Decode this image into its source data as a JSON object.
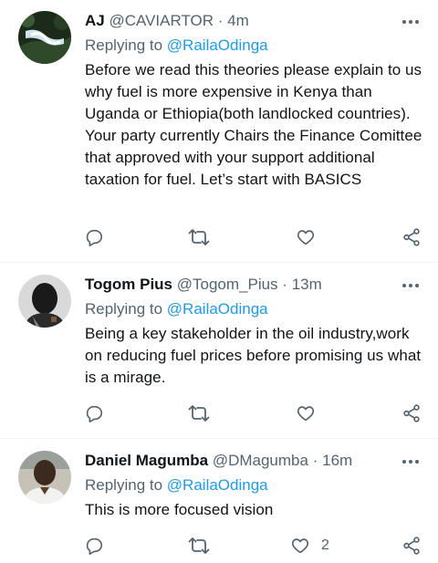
{
  "replies": [
    {
      "name": "AJ",
      "handle": "@CAVIARTOR",
      "separator": "·",
      "time": "4m",
      "replying_prefix": "Replying to",
      "replying_handle": "@RailaOdinga",
      "text": "Before we read this theories please explain to us why fuel is more expensive in Kenya than Uganda or Ethiopia(both landlocked countries). Your party currently Chairs the Finance Comittee that approved with your support additional taxation for fuel. Let’s start with BASICS",
      "like_count": ""
    },
    {
      "name": "Togom Pius",
      "handle": "@Togom_Pius",
      "separator": "·",
      "time": "13m",
      "replying_prefix": "Replying to",
      "replying_handle": "@RailaOdinga",
      "text": "Being a key stakeholder in the oil industry,work on reducing fuel prices before promising us what is a mirage.",
      "like_count": ""
    },
    {
      "name": "Daniel Magumba",
      "handle": "@DMagumba",
      "separator": "·",
      "time": "16m",
      "replying_prefix": "Replying to",
      "replying_handle": "@RailaOdinga",
      "text": "This is more focused vision",
      "like_count": "2"
    }
  ],
  "icons": {
    "more": "more-dots-icon",
    "reply": "reply-icon",
    "retweet": "retweet-icon",
    "like": "heart-icon",
    "share": "share-icon"
  },
  "colors": {
    "link": "#1d9bf0",
    "secondary_text": "#536471",
    "primary_text": "#0f1419",
    "divider": "#eff3f4"
  }
}
